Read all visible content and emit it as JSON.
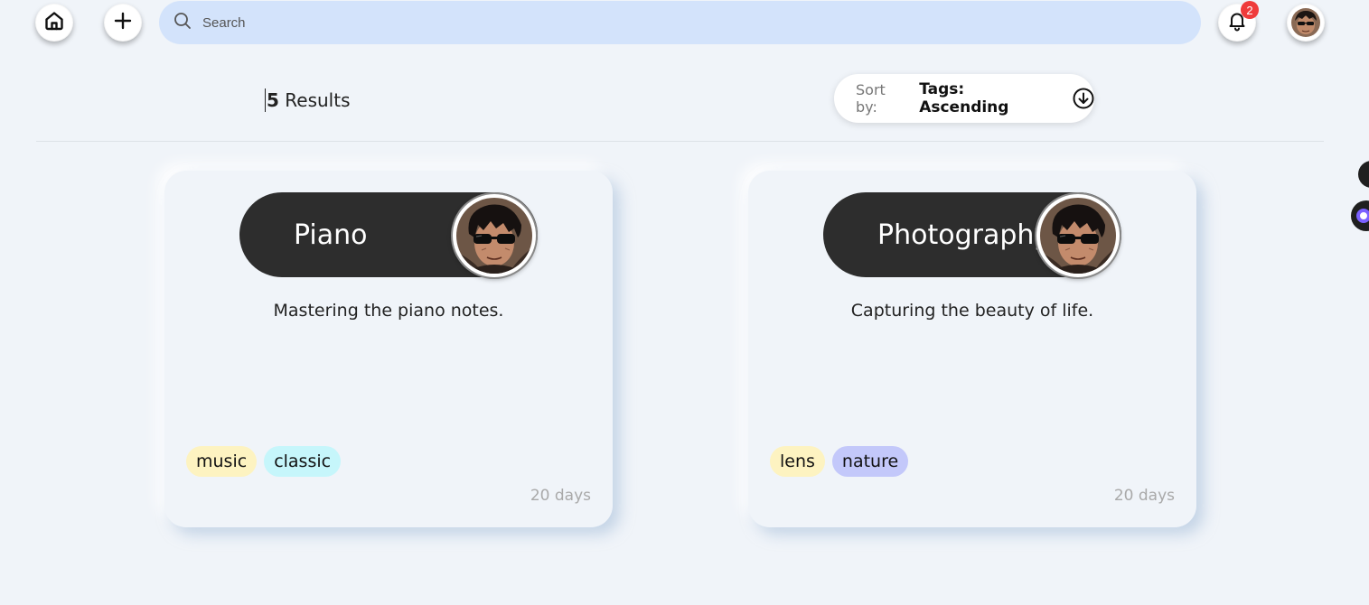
{
  "header": {
    "search_placeholder": "Search",
    "notification_count": "2",
    "icons": {
      "home": "home-icon",
      "add": "plus-icon",
      "search": "search-icon",
      "bell": "bell-icon"
    }
  },
  "results": {
    "count": "5",
    "label": " Results"
  },
  "sort": {
    "label": "Sort by:",
    "value": "Tags: Ascending",
    "icon": "arrow-down-circle-icon"
  },
  "cards": [
    {
      "title": "Piano",
      "description": "Mastering the piano notes.",
      "tags": [
        {
          "label": "music",
          "color": "#fdf3c1"
        },
        {
          "label": "classic",
          "color": "#c6f6fb"
        }
      ],
      "time": "20 days"
    },
    {
      "title": "Photography",
      "description": "Capturing the beauty of life.",
      "tags": [
        {
          "label": "lens",
          "color": "#fdf3c1"
        },
        {
          "label": "nature",
          "color": "#c3c8fa"
        }
      ],
      "time": "20 days"
    }
  ],
  "colors": {
    "background": "#f0f4f9",
    "search_bg": "#d3e3fb",
    "title_pill": "#2d2d2d",
    "badge": "#ef3b3b"
  }
}
